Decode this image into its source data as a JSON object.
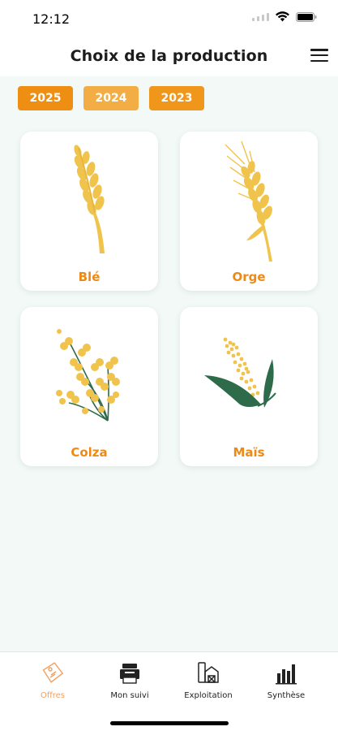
{
  "status_bar": {
    "time": "12:12"
  },
  "header": {
    "title": "Choix de la production",
    "menu_icon": "hamburger-menu-icon"
  },
  "year_tabs": [
    {
      "label": "2025"
    },
    {
      "label": "2024"
    },
    {
      "label": "2023"
    }
  ],
  "crops": [
    {
      "label": "Blé",
      "icon": "wheat-icon"
    },
    {
      "label": "Orge",
      "icon": "barley-icon"
    },
    {
      "label": "Colza",
      "icon": "rapeseed-icon"
    },
    {
      "label": "Maïs",
      "icon": "corn-icon"
    }
  ],
  "bottom_nav": [
    {
      "label": "Offres",
      "icon": "offers-tag-icon",
      "active": true
    },
    {
      "label": "Mon suivi",
      "icon": "tracking-icon",
      "active": false
    },
    {
      "label": "Exploitation",
      "icon": "farm-building-icon",
      "active": false
    },
    {
      "label": "Synthèse",
      "icon": "summary-chart-icon",
      "active": false
    }
  ],
  "colors": {
    "accent": "#ee8e13",
    "crop_label": "#ee8a14",
    "background": "#f2f9f7",
    "grain_yellow": "#f0c44c",
    "leaf_green": "#2e6b4a",
    "nav_active": "#f0a060"
  }
}
